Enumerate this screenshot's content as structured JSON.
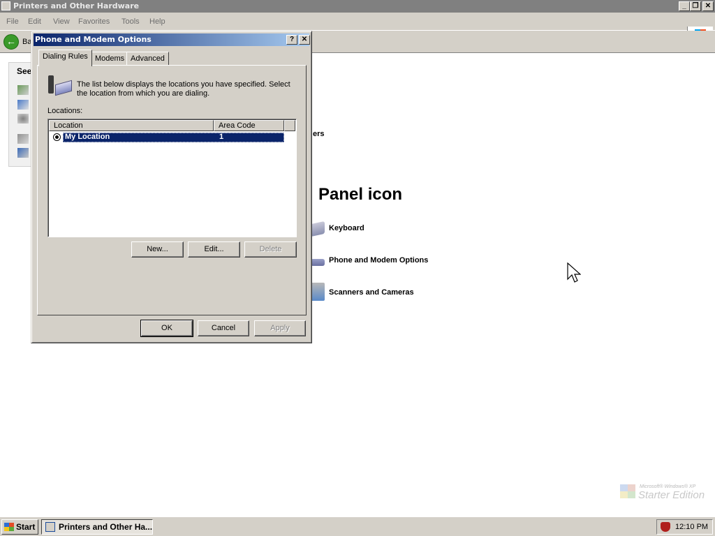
{
  "explorer": {
    "title": "Printers and Other Hardware",
    "menu": [
      "File",
      "Edit",
      "View",
      "Favorites",
      "Tools",
      "Help"
    ],
    "back_label": "Ba",
    "see_also_label": "See",
    "fragment_text": "ers",
    "panel_heading": "Panel icon",
    "items": [
      {
        "label": "Keyboard",
        "icon": "keyboard-icon"
      },
      {
        "label": "Phone and Modem Options",
        "icon": "phone-modem-icon"
      },
      {
        "label": "Scanners and Cameras",
        "icon": "scanner-camera-icon"
      }
    ]
  },
  "dialog": {
    "title": "Phone and Modem Options",
    "help_btn": "?",
    "close_btn": "✕",
    "tabs": [
      "Dialing Rules",
      "Modems",
      "Advanced"
    ],
    "active_tab": "Dialing Rules",
    "description": "The list below displays the locations you have specified. Select the location from which you are dialing.",
    "locations_label": "Locations:",
    "columns": [
      "Location",
      "Area Code"
    ],
    "rows": [
      {
        "location": "My Location",
        "area_code": "1",
        "selected": true
      }
    ],
    "buttons": {
      "new": "New...",
      "edit": "Edit...",
      "delete": "Delete"
    },
    "footer": {
      "ok": "OK",
      "cancel": "Cancel",
      "apply": "Apply"
    }
  },
  "taskbar": {
    "start": "Start",
    "task": "Printers and Other Ha...",
    "clock": "12:10 PM"
  },
  "watermark": {
    "line1": "Microsoft® Windows® XP",
    "line2": "Starter Edition"
  },
  "colors": {
    "title_active": "#0a246a",
    "title_inactive": "#808080",
    "face": "#d4d0c8",
    "selection": "#0a246a"
  }
}
